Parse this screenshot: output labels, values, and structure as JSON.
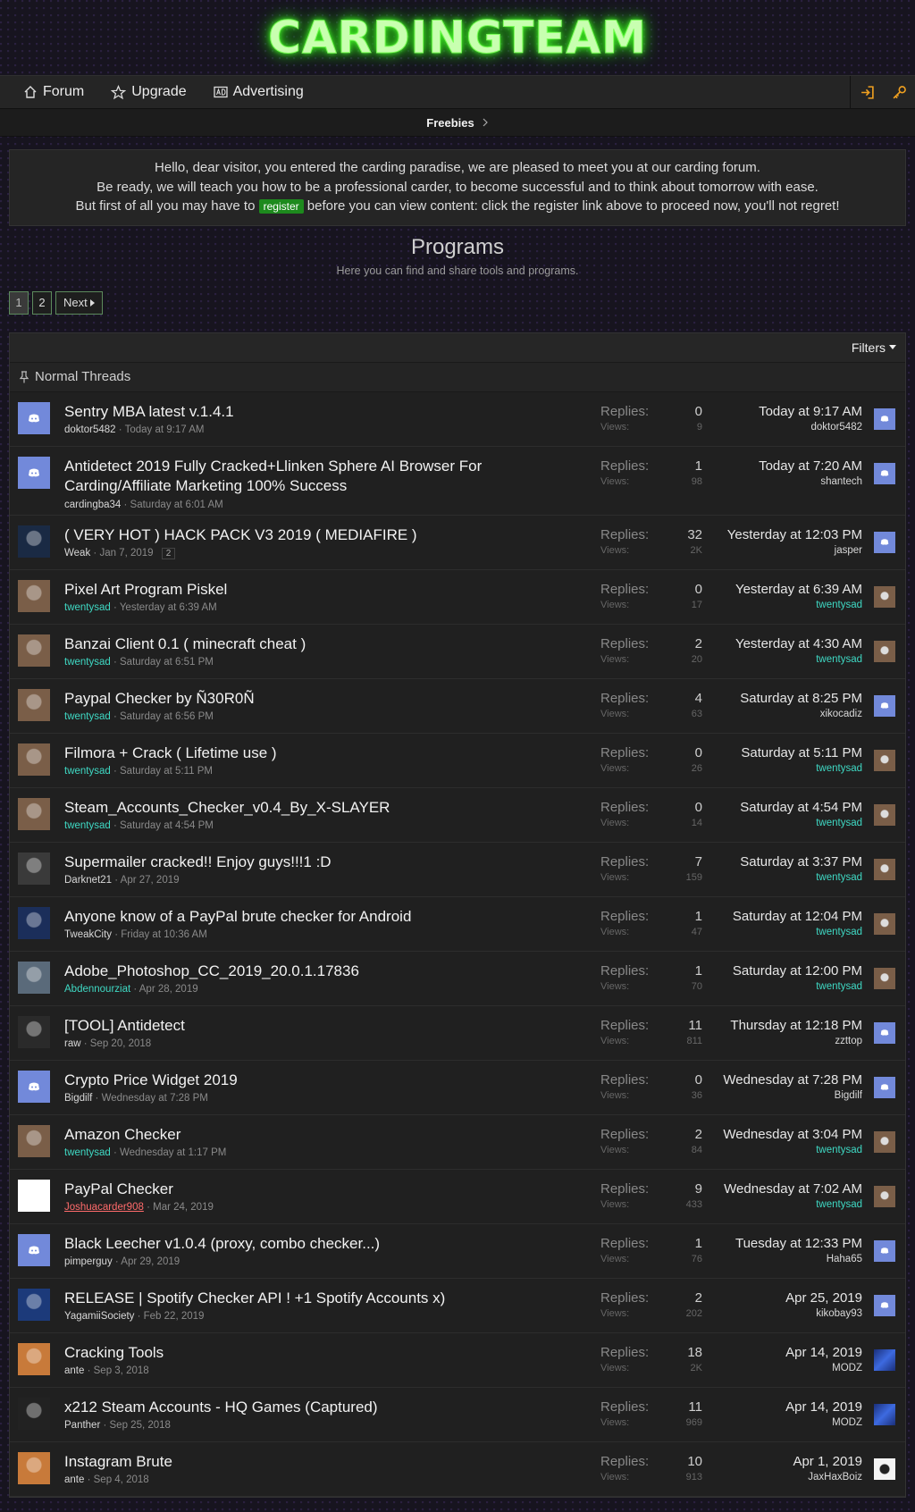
{
  "site": {
    "logo": "CARDINGTEAM"
  },
  "nav": {
    "forum": "Forum",
    "upgrade": "Upgrade",
    "advertising": "Advertising"
  },
  "breadcrumb": {
    "freebies": "Freebies"
  },
  "notice": {
    "line1": "Hello, dear visitor, you entered the carding paradise, we are pleased to meet you at our carding forum.",
    "line2": "Be ready, we will teach you how to be a professional carder, to become successful and to think about tomorrow with ease.",
    "line3a": "But first of all you may have to",
    "register": "register",
    "line3b": "before you can view content: click the register link above to proceed now, you'll not regret!"
  },
  "page": {
    "title": "Programs",
    "description": "Here you can find and share tools and programs."
  },
  "pagination": {
    "p1": "1",
    "p2": "2",
    "next": "Next"
  },
  "list": {
    "filters": "Filters",
    "group": "Normal Threads",
    "replies_label": "Replies:",
    "views_label": "Views:"
  },
  "threads": [
    {
      "title": "Sentry MBA latest v.1.4.1",
      "author": "doktor5482",
      "started": "Today at 9:17 AM",
      "replies": "0",
      "views": "9",
      "last_date": "Today at 9:17 AM",
      "last_user": "doktor5482",
      "avatar_color": "#7289da"
    },
    {
      "title": "Antidetect 2019 Fully Cracked+Llinken Sphere AI Browser For Carding/Affiliate Marketing 100% Success",
      "author": "cardingba34",
      "started": "Saturday at 6:01 AM",
      "replies": "1",
      "views": "98",
      "last_date": "Today at 7:20 AM",
      "last_user": "shantech",
      "avatar_color": "#7289da"
    },
    {
      "title": "( VERY HOT ) HACK PACK V3 2019 ( MEDIAFIRE )",
      "author": "Weak",
      "started": "Jan 7, 2019",
      "page": "2",
      "replies": "32",
      "views": "2K",
      "last_date": "Yesterday at 12:03 PM",
      "last_user": "jasper",
      "avatar_color": "#1a2a44"
    },
    {
      "title": "Pixel Art Program Piskel",
      "author": "twentysad",
      "started": "Yesterday at 6:39 AM",
      "replies": "0",
      "views": "17",
      "last_date": "Yesterday at 6:39 AM",
      "last_user": "twentysad",
      "avatar_color": "#7a5e48"
    },
    {
      "title": "Banzai Client 0.1 ( minecraft cheat )",
      "author": "twentysad",
      "started": "Saturday at 6:51 PM",
      "replies": "2",
      "views": "20",
      "last_date": "Yesterday at 4:30 AM",
      "last_user": "twentysad",
      "avatar_color": "#7a5e48"
    },
    {
      "title": "Paypal Checker by Ñ30R0Ñ",
      "author": "twentysad",
      "started": "Saturday at 6:56 PM",
      "replies": "4",
      "views": "63",
      "last_date": "Saturday at 8:25 PM",
      "last_user": "xikocadiz",
      "avatar_color": "#7a5e48"
    },
    {
      "title": "Filmora + Crack ( Lifetime use )",
      "author": "twentysad",
      "started": "Saturday at 5:11 PM",
      "replies": "0",
      "views": "26",
      "last_date": "Saturday at 5:11 PM",
      "last_user": "twentysad",
      "avatar_color": "#7a5e48"
    },
    {
      "title": "Steam_Accounts_Checker_v0.4_By_X-SLAYER",
      "author": "twentysad",
      "started": "Saturday at 4:54 PM",
      "replies": "0",
      "views": "14",
      "last_date": "Saturday at 4:54 PM",
      "last_user": "twentysad",
      "avatar_color": "#7a5e48"
    },
    {
      "title": "Supermailer cracked!! Enjoy guys!!!1 :D",
      "author": "Darknet21",
      "started": "Apr 27, 2019",
      "replies": "7",
      "views": "159",
      "last_date": "Saturday at 3:37 PM",
      "last_user": "twentysad",
      "avatar_color": "#3a3a3a"
    },
    {
      "title": "Anyone know of a PayPal brute checker for Android",
      "author": "TweakCity",
      "started": "Friday at 10:36 AM",
      "replies": "1",
      "views": "47",
      "last_date": "Saturday at 12:04 PM",
      "last_user": "twentysad",
      "avatar_color": "#1b2e5a"
    },
    {
      "title": "Adobe_Photoshop_CC_2019_20.0.1.17836",
      "author": "Abdennourziat",
      "started": "Apr 28, 2019",
      "replies": "1",
      "views": "70",
      "last_date": "Saturday at 12:00 PM",
      "last_user": "twentysad",
      "avatar_color": "#5a6a7a"
    },
    {
      "title": "[TOOL] Antidetect",
      "author": "raw",
      "started": "Sep 20, 2018",
      "replies": "11",
      "views": "811",
      "last_date": "Thursday at 12:18 PM",
      "last_user": "zzttop",
      "avatar_color": "#2a2a2a"
    },
    {
      "title": "Crypto Price Widget 2019",
      "author": "Bigdilf",
      "started": "Wednesday at 7:28 PM",
      "replies": "0",
      "views": "36",
      "last_date": "Wednesday at 7:28 PM",
      "last_user": "Bigdilf",
      "avatar_color": "#7289da"
    },
    {
      "title": "Amazon Checker",
      "author": "twentysad",
      "started": "Wednesday at 1:17 PM",
      "replies": "2",
      "views": "84",
      "last_date": "Wednesday at 3:04 PM",
      "last_user": "twentysad",
      "avatar_color": "#7a5e48"
    },
    {
      "title": "PayPal Checker",
      "author": "Joshuacarder908",
      "started": "Mar 24, 2019",
      "replies": "9",
      "views": "433",
      "last_date": "Wednesday at 7:02 AM",
      "last_user": "twentysad",
      "avatar_color": "#ffffff"
    },
    {
      "title": "Black Leecher v1.0.4 (proxy, combo checker...)",
      "author": "pimperguy",
      "started": "Apr 29, 2019",
      "replies": "1",
      "views": "76",
      "last_date": "Tuesday at 12:33 PM",
      "last_user": "Haha65",
      "avatar_color": "#7289da"
    },
    {
      "title": "RELEASE | Spotify Checker API ! +1 Spotify Accounts x)",
      "author": "YagamiiSociety",
      "started": "Feb 22, 2019",
      "replies": "2",
      "views": "202",
      "last_date": "Apr 25, 2019",
      "last_user": "kikobay93",
      "avatar_color": "#1c3a7a"
    },
    {
      "title": "Cracking Tools",
      "author": "ante",
      "started": "Sep 3, 2018",
      "replies": "18",
      "views": "2K",
      "last_date": "Apr 14, 2019",
      "last_user": "MODZ",
      "avatar_color": "#c87a3a"
    },
    {
      "title": "x212 Steam Accounts - HQ Games (Captured)",
      "author": "Panther",
      "started": "Sep 25, 2018",
      "replies": "11",
      "views": "969",
      "last_date": "Apr 14, 2019",
      "last_user": "MODZ",
      "avatar_color": "#222222"
    },
    {
      "title": "Instagram Brute",
      "author": "ante",
      "started": "Sep 4, 2018",
      "replies": "10",
      "views": "913",
      "last_date": "Apr 1, 2019",
      "last_user": "JaxHaxBoiz",
      "avatar_color": "#c87a3a"
    }
  ]
}
